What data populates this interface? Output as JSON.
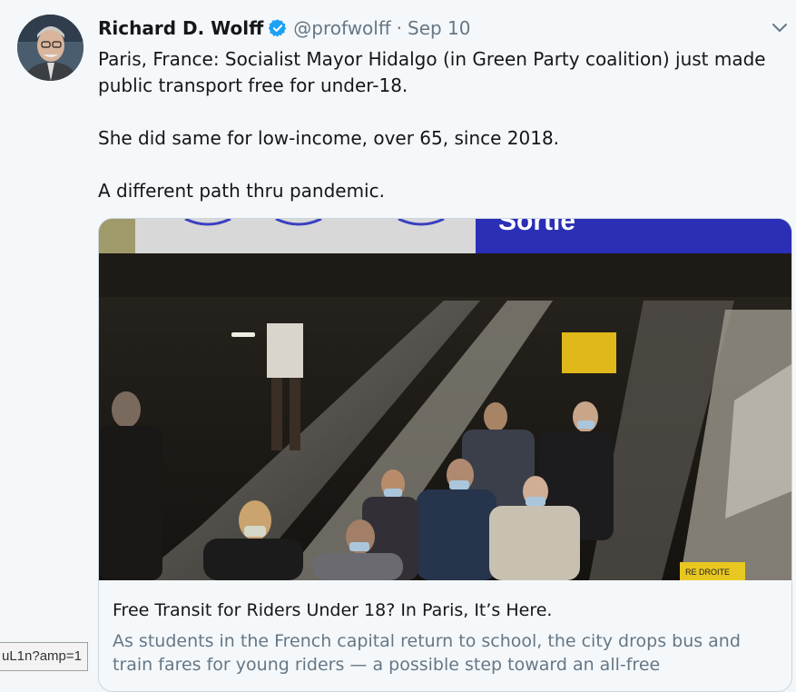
{
  "tweet": {
    "author_name": "Richard D. Wolff",
    "handle": "@profwolff",
    "separator": "·",
    "date": "Sep 10",
    "paragraphs": [
      "Paris, France: Socialist Mayor Hidalgo (in Green Party coalition) just made public transport free for under-18.",
      "She did same for low-income, over 65, since 2018.",
      "A different path thru pandemic."
    ],
    "icons": {
      "verified": "verified-badge-icon",
      "menu": "chevron-down-icon"
    }
  },
  "card": {
    "title": "Free Transit for Riders Under 18? In Paris, It’s Here.",
    "description": "As students in the French capital return to school, the city drops bus and train fares for young riders — a possible step toward an all-free",
    "image_alt": "Masked commuters riding escalators in a Paris metro station",
    "sign_text": "Sortie",
    "floor_sign_text": "RE DROITE"
  },
  "status_bar": {
    "url": "uL1n?amp=1"
  },
  "colors": {
    "verified": "#1da1f2",
    "secondary_text": "#657786",
    "border": "#ccd6dd",
    "sign_blue": "#2b2fb6"
  }
}
